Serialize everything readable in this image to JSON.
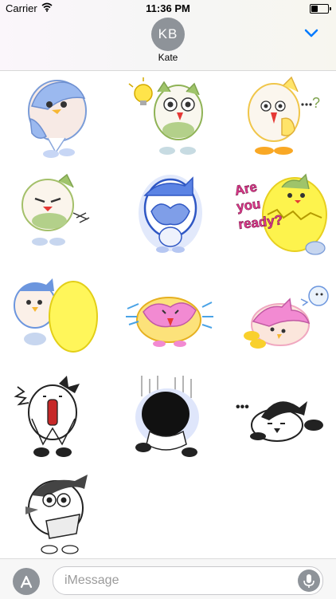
{
  "status_bar": {
    "carrier": "Carrier",
    "time": "11:36 PM"
  },
  "header": {
    "avatar_initials": "KB",
    "contact_name": "Kate"
  },
  "stickers": [
    {
      "name": "sticker-1",
      "description": "blue-bird-hand-over-mouth"
    },
    {
      "name": "sticker-2",
      "description": "green-bird-lightbulb-idea"
    },
    {
      "name": "sticker-3",
      "description": "yellow-bird-question"
    },
    {
      "name": "sticker-4",
      "description": "green-bird-angry"
    },
    {
      "name": "sticker-5",
      "description": "blue-bird-glow-praying"
    },
    {
      "name": "sticker-6",
      "description": "yellow-egg-are-you-ready",
      "text": "Are you ready?"
    },
    {
      "name": "sticker-7",
      "description": "blue-bird-with-egg"
    },
    {
      "name": "sticker-8",
      "description": "pink-yellow-bird-crying"
    },
    {
      "name": "sticker-9",
      "description": "pink-bird-lying"
    },
    {
      "name": "sticker-10",
      "description": "bw-bird-shocked"
    },
    {
      "name": "sticker-11",
      "description": "black-bird-gloom"
    },
    {
      "name": "sticker-12",
      "description": "bw-bird-lying-dots",
      "text": "•••"
    },
    {
      "name": "sticker-13",
      "description": "bw-bird-surprised"
    }
  ],
  "input": {
    "placeholder": "iMessage"
  },
  "colors": {
    "accent": "#007aff",
    "avatar_gray": "#8e9399"
  }
}
